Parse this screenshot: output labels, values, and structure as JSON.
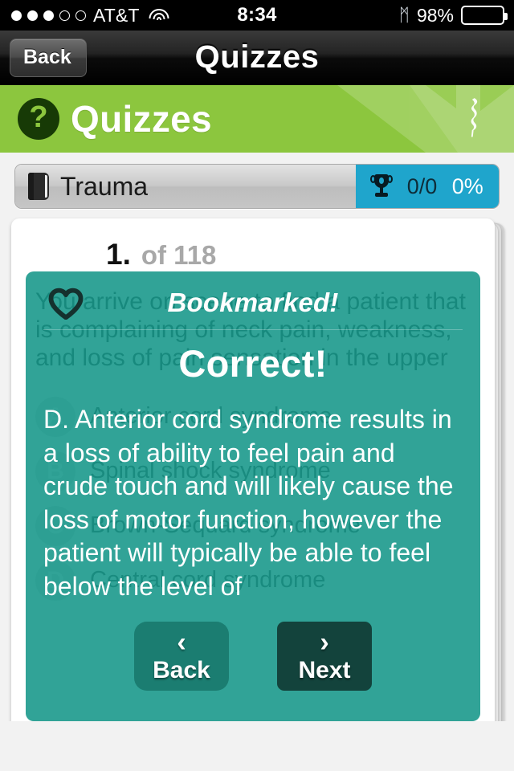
{
  "statusbar": {
    "carrier": "AT&T",
    "time": "8:34",
    "battery_pct": "98%",
    "signal_dots_total": 5,
    "signal_dots_filled": 3,
    "wifi_icon": "wifi-icon",
    "bluetooth_icon": "bluetooth-icon",
    "bluetooth_glyph": "ᛗ"
  },
  "navbar": {
    "back_label": "Back",
    "title": "Quizzes"
  },
  "banner": {
    "badge_glyph": "?",
    "title": "Quizzes",
    "color": "#8cc63e",
    "badge_color": "#173a06"
  },
  "topic": {
    "book_icon": "book-icon",
    "name": "Trauma",
    "trophy_icon": "trophy-icon",
    "score_fraction": "0/0",
    "score_percent": "0%",
    "score_bg_color": "#1fa5cc"
  },
  "question": {
    "number": "1.",
    "of_total": "of 118",
    "text": "You arrive on scene to find a patient that is complaining of neck pain, weakness, and loss of pain sensation in the upper",
    "options": [
      {
        "letter": "A",
        "text": "Anterior cord syndrome"
      },
      {
        "letter": "B",
        "text": "Spinal shock syndrome"
      },
      {
        "letter": "C",
        "text": "Brown-Sequard syndrome"
      },
      {
        "letter": "D",
        "text": "Central cord syndrome"
      }
    ]
  },
  "overlay": {
    "heart_icon": "heart-icon",
    "bookmarked_label": "Bookmarked!",
    "verdict": "Correct!",
    "explanation": "D. Anterior cord syndrome results in a loss of ability to feel pain and crude touch and will likely cause the loss of motor function, however the patient will typically be able to feel below the level of",
    "back_label": "Back",
    "back_chevron": "‹",
    "next_label": "Next",
    "next_chevron": "›",
    "bg_color": "#149689",
    "back_btn_color": "#1b7d71",
    "next_btn_color": "#13433c"
  }
}
